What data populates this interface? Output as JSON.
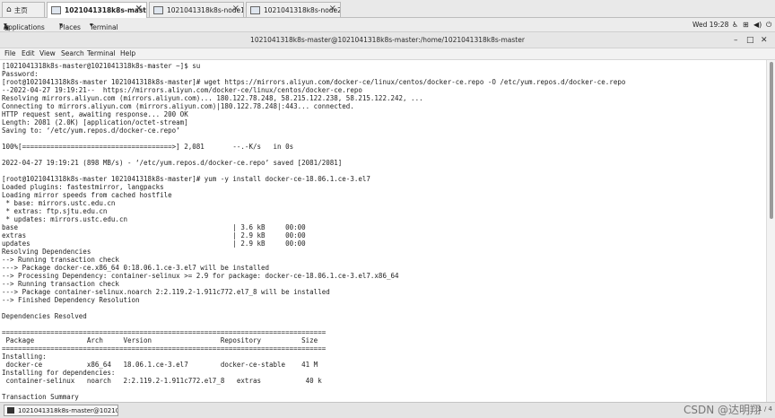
{
  "vm_tabs": [
    {
      "label": "主页",
      "icon": "home-icon",
      "active": false
    },
    {
      "label": "1021041318k8s-master",
      "icon": "vm-icon",
      "active": true
    },
    {
      "label": "1021041318k8s-node1",
      "icon": "vm-icon",
      "active": false
    },
    {
      "label": "1021041318k8s-node2",
      "icon": "vm-icon",
      "active": false
    }
  ],
  "gnome_bar": {
    "applications": "Applications",
    "places": "Places",
    "terminal": "Terminal",
    "clock": "Wed 19:28"
  },
  "window": {
    "title": "1021041318k8s-master@1021041318k8s-master:/home/1021041318k8s-master"
  },
  "menu": [
    "File",
    "Edit",
    "View",
    "Search",
    "Terminal",
    "Help"
  ],
  "terminal_lines": [
    "[1021041318k8s-master@1021041318k8s-master ~]$ su",
    "Password:",
    "[root@1021041318k8s-master 1021041318k8s-master]# wget https://mirrors.aliyun.com/docker-ce/linux/centos/docker-ce.repo -O /etc/yum.repos.d/docker-ce.repo",
    "--2022-04-27 19:19:21--  https://mirrors.aliyun.com/docker-ce/linux/centos/docker-ce.repo",
    "Resolving mirrors.aliyun.com (mirrors.aliyun.com)... 180.122.78.248, 58.215.122.238, 58.215.122.242, ...",
    "Connecting to mirrors.aliyun.com (mirrors.aliyun.com)|180.122.78.248|:443... connected.",
    "HTTP request sent, awaiting response... 200 OK",
    "Length: 2081 (2.0K) [application/octet-stream]",
    "Saving to: ‘/etc/yum.repos.d/docker-ce.repo’",
    "",
    "100%[=====================================>] 2,081       --.-K/s   in 0s",
    "",
    "2022-04-27 19:19:21 (898 MB/s) - ‘/etc/yum.repos.d/docker-ce.repo’ saved [2081/2081]",
    "",
    "[root@1021041318k8s-master 1021041318k8s-master]# yum -y install docker-ce-18.06.1.ce-3.el7",
    "Loaded plugins: fastestmirror, langpacks",
    "Loading mirror speeds from cached hostfile",
    " * base: mirrors.ustc.edu.cn",
    " * extras: ftp.sjtu.edu.cn",
    " * updates: mirrors.ustc.edu.cn",
    "base                                                     | 3.6 kB     00:00",
    "extras                                                   | 2.9 kB     00:00",
    "updates                                                  | 2.9 kB     00:00",
    "Resolving Dependencies",
    "--> Running transaction check",
    "---> Package docker-ce.x86_64 0:18.06.1.ce-3.el7 will be installed",
    "--> Processing Dependency: container-selinux >= 2.9 for package: docker-ce-18.06.1.ce-3.el7.x86_64",
    "--> Running transaction check",
    "---> Package container-selinux.noarch 2:2.119.2-1.911c772.el7_8 will be installed",
    "--> Finished Dependency Resolution",
    "",
    "Dependencies Resolved",
    "",
    "================================================================================",
    " Package             Arch     Version                 Repository          Size",
    "================================================================================",
    "Installing:",
    " docker-ce           x86_64   18.06.1.ce-3.el7        docker-ce-stable    41 M",
    "Installing for dependencies:",
    " container-selinux   noarch   2:2.119.2-1.911c772.el7_8   extras           40 k",
    "",
    "Transaction Summary"
  ],
  "taskbar": {
    "task_label": "1021041318k8s-master@102104...",
    "watermark": "CSDN @达明翔",
    "page_indicator": "1 / 4"
  }
}
